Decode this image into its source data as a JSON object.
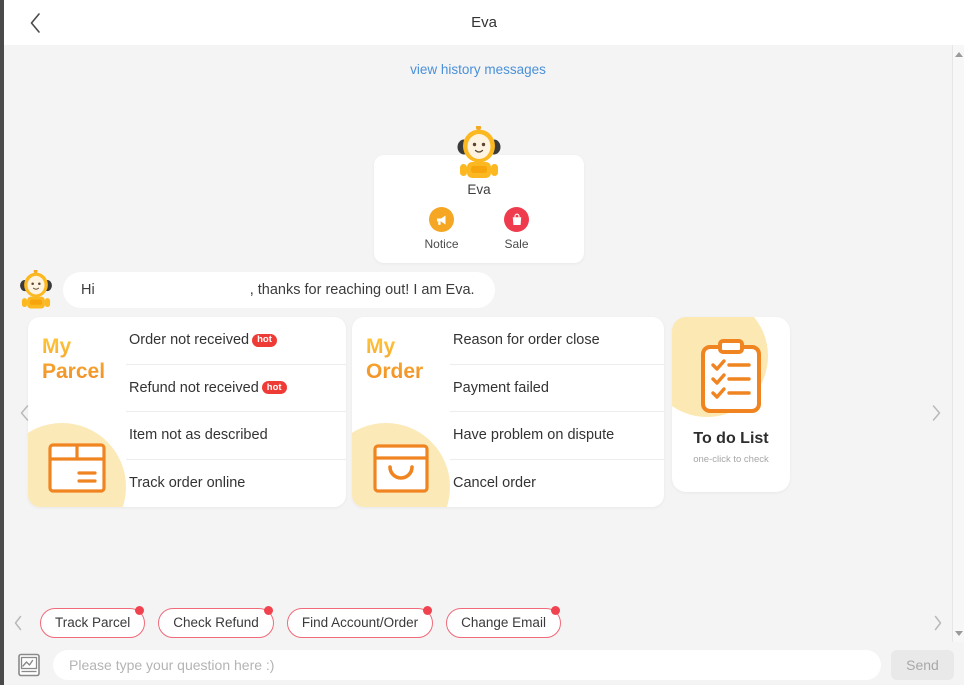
{
  "header": {
    "title": "Eva",
    "back_icon": "chevron-left-icon"
  },
  "chat": {
    "history_link": "view history messages",
    "eva_card": {
      "name": "Eva",
      "avatar_icon": "eva-robot-avatar",
      "actions": [
        {
          "label": "Notice",
          "icon": "megaphone-icon",
          "color": "#f5a623"
        },
        {
          "label": "Sale",
          "icon": "shopping-bag-icon",
          "color": "#ef3b4e"
        }
      ]
    },
    "greeting": {
      "avatar_icon": "eva-robot-avatar",
      "prefix": "Hi",
      "suffix": ", thanks for reaching out! I am Eva."
    }
  },
  "cards": {
    "prev_icon": "chevron-left-icon",
    "next_icon": "chevron-right-icon",
    "menu": [
      {
        "title_line1": "My",
        "title_line2": "Parcel",
        "icon": "parcel-box-icon",
        "items": [
          {
            "label": "Order not received",
            "badge": "hot"
          },
          {
            "label": "Refund not received",
            "badge": "hot"
          },
          {
            "label": "Item not as described",
            "badge": ""
          },
          {
            "label": "Track order online",
            "badge": ""
          }
        ]
      },
      {
        "title_line1": "My",
        "title_line2": "Order",
        "icon": "shopping-bag-icon",
        "items": [
          {
            "label": "Reason for order close",
            "badge": ""
          },
          {
            "label": "Payment failed",
            "badge": ""
          },
          {
            "label": "Have problem on dispute",
            "badge": ""
          },
          {
            "label": "Cancel order",
            "badge": ""
          }
        ]
      }
    ],
    "todo": {
      "title": "To do List",
      "subtitle": "one-click to check",
      "icon": "clipboard-checklist-icon"
    }
  },
  "quick_replies": {
    "prev_icon": "chevron-left-icon",
    "next_icon": "chevron-right-icon",
    "chips": [
      {
        "label": "Track Parcel"
      },
      {
        "label": "Check Refund"
      },
      {
        "label": "Find Account/Order"
      },
      {
        "label": "Change Email"
      }
    ]
  },
  "input_bar": {
    "gallery_icon": "image-upload-icon",
    "placeholder": "Please type your question here :)",
    "value": "",
    "send_label": "Send"
  },
  "colors": {
    "accent_orange": "#f08a24",
    "accent_yellow": "#ffc93c",
    "badge_red": "#ee3b36",
    "chip_border": "#f06a7a",
    "link_blue": "#4a90d9"
  }
}
